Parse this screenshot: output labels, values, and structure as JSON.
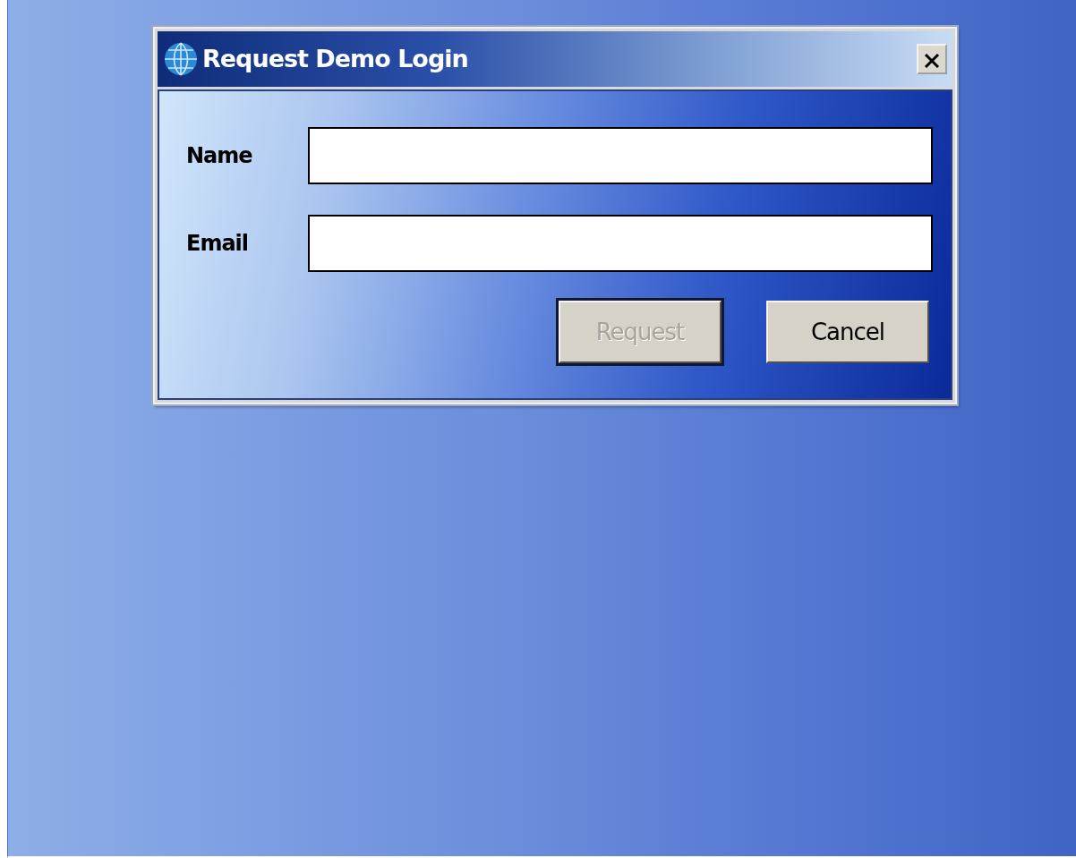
{
  "window": {
    "title": "Request Demo Login"
  },
  "fields": [
    {
      "label": "Name"
    },
    {
      "label": "Email"
    }
  ],
  "buttons": [
    {
      "label": "Request",
      "disabled": true,
      "default": true
    },
    {
      "label": "Cancel",
      "disabled": false,
      "default": false
    }
  ]
}
